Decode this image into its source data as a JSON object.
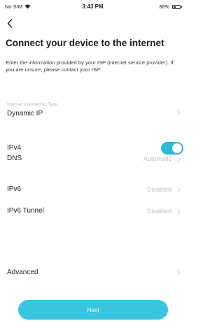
{
  "status_bar": {
    "carrier": "No SIM",
    "time": "3:43 PM",
    "battery_text": "36%",
    "battery_level": 0.36,
    "wifi_icon": "wifi-icon",
    "battery_icon": "battery-icon"
  },
  "header": {
    "back_icon": "chevron-left-icon",
    "title": "Connect your device to the internet",
    "description": "Enter the information provided by your ISP (internet service provider). If you are unsure, please contact your ISP."
  },
  "settings": {
    "connection_type": {
      "label": "Internet Connection Type",
      "value": "Dynamic IP"
    },
    "ipv4": {
      "label": "IPv4",
      "enabled": true
    },
    "dns": {
      "label": "DNS",
      "value": "Automatic"
    },
    "ipv6": {
      "label": "IPv6",
      "value": "Disabled"
    },
    "ipv6_tunnel": {
      "label": "IPv6 Tunnel",
      "value": "Disabled"
    },
    "advanced": {
      "label": "Advanced"
    }
  },
  "footer": {
    "next_label": "Next"
  },
  "colors": {
    "accent": "#39c5e0",
    "toggle_on": "#2cb8d6",
    "value_text": "#c2c2c2",
    "label_text": "#1f1f1f"
  }
}
